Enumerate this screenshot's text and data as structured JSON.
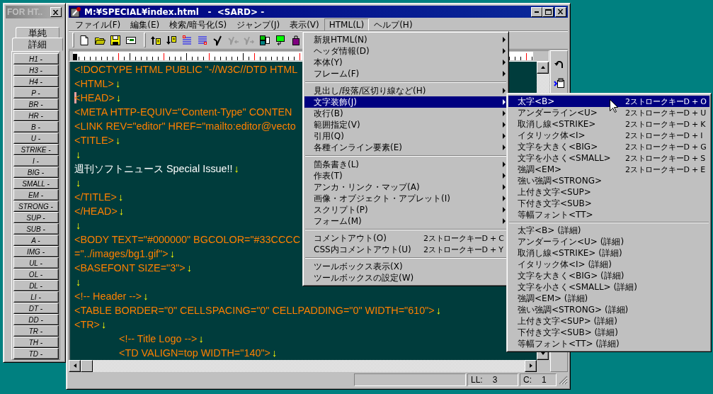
{
  "palette": {
    "title": "FOR HT..",
    "tabs": [
      {
        "label": "単純",
        "selected": false
      },
      {
        "label": "詳細",
        "selected": true
      }
    ],
    "buttons": [
      "H1 -",
      "H3 -",
      "H4 -",
      "P -",
      "BR -",
      "HR -",
      "B -",
      "U -",
      "STRIKE -",
      "I -",
      "BIG -",
      "SMALL -",
      "EM -",
      "STRONG -",
      "SUP -",
      "SUB -",
      "A -",
      "IMG -",
      "UL -",
      "OL -",
      "DL -",
      "LI -",
      "DT -",
      "DD -",
      "TR -",
      "TH -",
      "TD -"
    ]
  },
  "window": {
    "title": "M:¥SPECIAL¥index.html   -  <SARD> -"
  },
  "menu_bar": [
    {
      "label": "ファイル(F)",
      "selected": false
    },
    {
      "label": "編集(E)",
      "selected": false
    },
    {
      "label": "検索/暗号化(S)",
      "selected": false
    },
    {
      "label": "ジャンプ(J)",
      "selected": false
    },
    {
      "label": "表示(V)",
      "selected": false
    },
    {
      "label": "HTML(L)",
      "selected": true
    },
    {
      "label": "ヘルプ(H)",
      "selected": false
    }
  ],
  "toolbar": [
    {
      "disabled": false
    },
    {
      "disabled": false
    },
    {
      "disabled": false
    },
    {
      "disabled": false
    },
    {
      "disabled": false
    },
    {
      "disabled": false
    },
    {
      "disabled": false
    },
    {
      "disabled": false
    },
    {
      "disabled": false
    },
    {
      "disabled": true
    },
    {
      "disabled": true
    },
    {
      "disabled": false
    },
    {
      "disabled": false
    },
    {
      "disabled": false
    }
  ],
  "editor": {
    "lines": [
      {
        "kind": "tag",
        "text": "<!DOCTYPE HTML PUBLIC \"-//W3C//DTD HTML",
        "caret": false,
        "indented": false
      },
      {
        "kind": "tag",
        "text": "<HTML>",
        "eol": "↓",
        "caret": false,
        "indented": false
      },
      {
        "kind": "tag",
        "text": "<HEAD>",
        "eol": "↓",
        "caret": true,
        "indented": false
      },
      {
        "kind": "tag",
        "text": "<META HTTP-EQUIV=\"Content-Type\" CONTEN",
        "caret": false,
        "indented": false
      },
      {
        "kind": "tag",
        "text": "<LINK REV=\"editor\" HREF=\"mailto:editor@vecto",
        "caret": false,
        "indented": false
      },
      {
        "kind": "tag",
        "text": "<TITLE>",
        "eol": "↓",
        "caret": false,
        "indented": false
      },
      {
        "kind": "tag",
        "eol": "↓",
        "caret": false,
        "indented": false
      },
      {
        "kind": "text",
        "text": "週刊ソフトニュース Special Issue!!",
        "eol": "↓",
        "caret": false,
        "indented": false
      },
      {
        "kind": "tag",
        "eol": "↓",
        "caret": false,
        "indented": false
      },
      {
        "kind": "tag",
        "text": "</TITLE>",
        "eol": "↓",
        "caret": false,
        "indented": false
      },
      {
        "kind": "tag",
        "text": "</HEAD>",
        "eol": "↓",
        "caret": false,
        "indented": false
      },
      {
        "kind": "tag",
        "eol": "↓",
        "caret": false,
        "indented": false
      },
      {
        "kind": "tag",
        "text": "<BODY TEXT=\"#000000\" BGCOLOR=\"#33CCCC",
        "caret": false,
        "indented": false
      },
      {
        "kind": "tag",
        "text": "=\"../images/bg1.gif\">",
        "eol": "↓",
        "caret": false,
        "indented": false
      },
      {
        "kind": "tag",
        "text": "<BASEFONT SIZE=\"3\">",
        "eol": "↓",
        "caret": false,
        "indented": false
      },
      {
        "kind": "tag",
        "eol": "↓",
        "caret": false,
        "indented": false
      },
      {
        "kind": "tag",
        "text": "<!-- Header -->",
        "eol": "↓",
        "caret": false,
        "indented": false
      },
      {
        "kind": "tag",
        "text": "<TABLE BORDER=\"0\" CELLSPACING=\"0\" CELLPADDING=\"0\" WIDTH=\"610\">",
        "eol": "↓",
        "caret": false,
        "indented": false
      },
      {
        "kind": "tag",
        "text": "<TR>",
        "eol": "↓",
        "caret": false,
        "indented": false
      },
      {
        "kind": "tag",
        "text": "<!-- Title Logo -->",
        "eol": "↓",
        "caret": false,
        "indented": true
      },
      {
        "kind": "tag",
        "text": "<TD VALIGN=top WIDTH=\"140\">",
        "eol": "↓",
        "caret": false,
        "indented": true
      }
    ]
  },
  "status_bar": {
    "line_label": "LL:",
    "line": "3",
    "column_label": "C:",
    "column": "1"
  },
  "html_menu": {
    "groups": [
      [
        {
          "label": "新規HTML(N)",
          "submenu": true,
          "selected": false
        },
        {
          "label": "ヘッダ情報(D)",
          "submenu": true,
          "selected": false
        },
        {
          "label": "本体(Y)",
          "submenu": true,
          "selected": false
        },
        {
          "label": "フレーム(F)",
          "submenu": true,
          "selected": false
        }
      ],
      [
        {
          "label": "見出し/段落/区切り線など(H)",
          "submenu": true,
          "selected": false
        },
        {
          "label": "文字装飾(J)",
          "submenu": true,
          "selected": true
        },
        {
          "label": "改行(B)",
          "submenu": true,
          "selected": false
        },
        {
          "label": "範囲指定(V)",
          "submenu": true,
          "selected": false
        },
        {
          "label": "引用(Q)",
          "submenu": true,
          "selected": false
        },
        {
          "label": "各種インライン要素(E)",
          "submenu": true,
          "selected": false
        }
      ],
      [
        {
          "label": "箇条書き(L)",
          "submenu": true,
          "selected": false
        },
        {
          "label": "作表(T)",
          "submenu": true,
          "selected": false
        },
        {
          "label": "アンカ・リンク・マップ(A)",
          "submenu": true,
          "selected": false
        },
        {
          "label": "画像・オブジェクト・アプレット(I)",
          "submenu": true,
          "selected": false
        },
        {
          "label": "スクリプト(P)",
          "submenu": true,
          "selected": false
        },
        {
          "label": "フォーム(M)",
          "submenu": true,
          "selected": false
        }
      ],
      [
        {
          "label": "コメントアウト(O)",
          "shortcut": "2ストロークキーD + C",
          "submenu": false,
          "selected": false
        },
        {
          "label": "CSS内コメントアウト(U)",
          "shortcut": "2ストロークキーD + Y",
          "submenu": false,
          "selected": false
        }
      ],
      [
        {
          "label": "ツールボックス表示(X)",
          "submenu": false,
          "selected": false
        },
        {
          "label": "ツールボックスの設定(W)",
          "submenu": false,
          "selected": false
        }
      ]
    ]
  },
  "decoration_menu": {
    "groups": [
      [
        {
          "label": "太字<B>",
          "shortcut": "2ストロークキーD + O",
          "selected": true
        },
        {
          "label": "アンダーライン<U>",
          "shortcut": "2ストロークキーD + U",
          "selected": false
        },
        {
          "label": "取消し線<STRIKE>",
          "shortcut": "2ストロークキーD + K",
          "selected": false
        },
        {
          "label": "イタリック体<I>",
          "shortcut": "2ストロークキーD + I",
          "selected": false
        },
        {
          "label": "文字を大きく<BIG>",
          "shortcut": "2ストロークキーD + G",
          "selected": false
        },
        {
          "label": "文字を小さく<SMALL>",
          "shortcut": "2ストロークキーD + S",
          "selected": false
        },
        {
          "label": "強調<EM>",
          "shortcut": "2ストロークキーD + E",
          "selected": false
        },
        {
          "label": "強い強調<STRONG>",
          "selected": false
        },
        {
          "label": "上付き文字<SUP>",
          "selected": false
        },
        {
          "label": "下付き文字<SUB>",
          "selected": false
        },
        {
          "label": "等幅フォント<TT>",
          "selected": false
        }
      ],
      [
        {
          "label": "太字<B> (詳細)",
          "selected": false
        },
        {
          "label": "アンダーライン<U> (詳細)",
          "selected": false
        },
        {
          "label": "取消し線<STRIKE> (詳細)",
          "selected": false
        },
        {
          "label": "イタリック体<I> (詳細)",
          "selected": false
        },
        {
          "label": "文字を大きく<BIG> (詳細)",
          "selected": false
        },
        {
          "label": "文字を小さく<SMALL> (詳細)",
          "selected": false
        },
        {
          "label": "強調<EM> (詳細)",
          "selected": false
        },
        {
          "label": "強い強調<STRONG> (詳細)",
          "selected": false
        },
        {
          "label": "上付き文字<SUP> (詳細)",
          "selected": false
        },
        {
          "label": "下付き文字<SUB> (詳細)",
          "selected": false
        },
        {
          "label": "等幅フォント<TT> (詳細)",
          "selected": false
        }
      ]
    ]
  }
}
